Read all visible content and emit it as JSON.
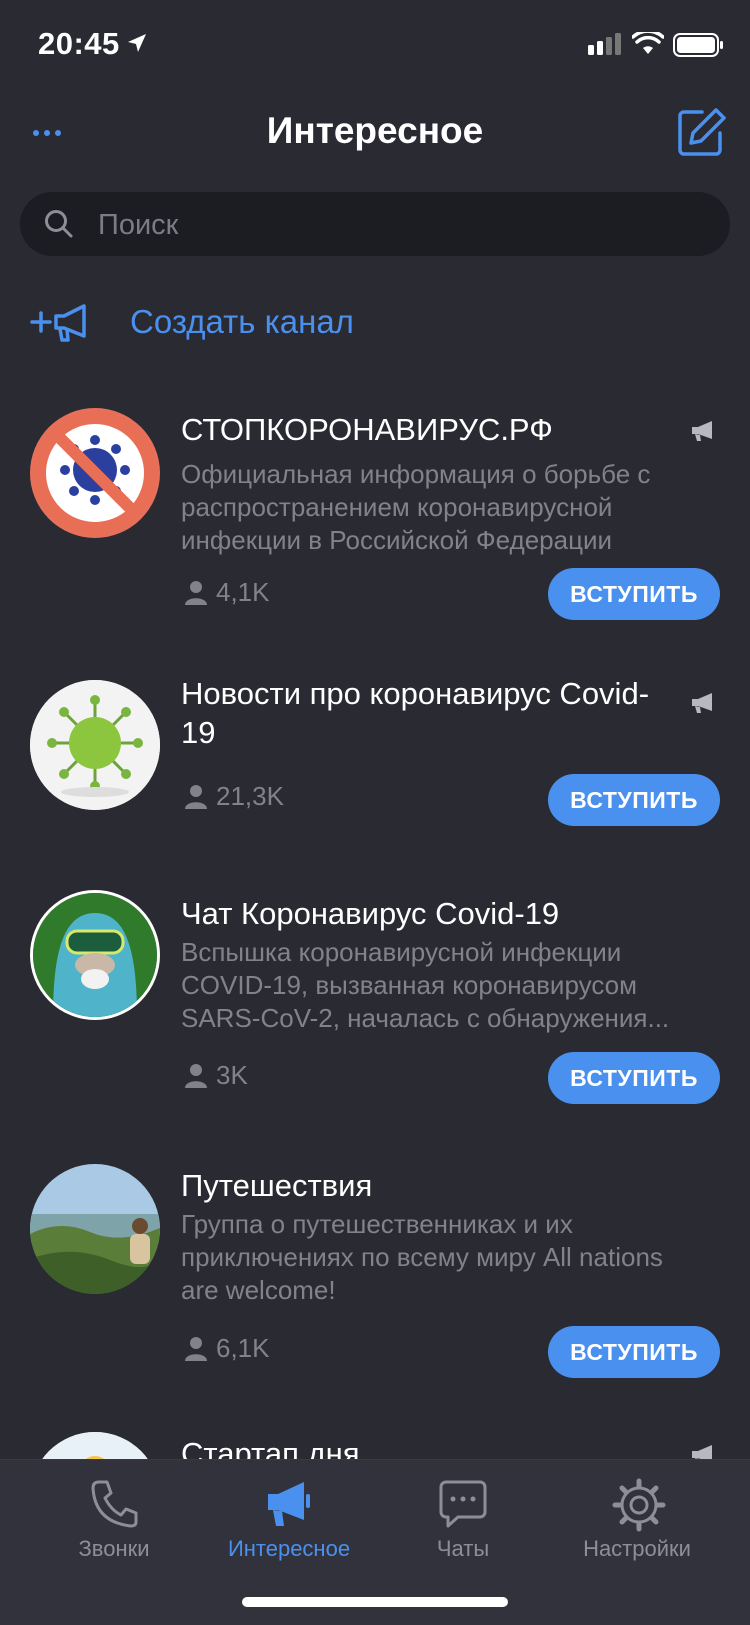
{
  "status": {
    "time": "20:45"
  },
  "header": {
    "title": "Интересное"
  },
  "search": {
    "placeholder": "Поиск"
  },
  "create_channel": {
    "label": "Создать канал"
  },
  "channels": [
    {
      "title": "СТОПКОРОНАВИРУС.РФ",
      "description": "Официальная информация о борьбе с распространением коронавирусной инфекции в Российской Федерации",
      "members": "4,1K",
      "join_label": "ВСТУПИТЬ",
      "is_channel": true
    },
    {
      "title": "Новости про коронавирус Covid-19",
      "description": "",
      "members": "21,3K",
      "join_label": "ВСТУПИТЬ",
      "is_channel": true
    },
    {
      "title": "Чат Коронавирус Covid-19",
      "description": "Вспышка коронавирусной инфекции COVID-19, вызванная коронавирусом SARS-CoV-2, началась с обнаружения...",
      "members": "3K",
      "join_label": "ВСТУПИТЬ",
      "is_channel": false
    },
    {
      "title": "Путешествия",
      "description": "Группа о путешественниках и их приключениях по всему миру  All nations are welcome!",
      "members": "6,1K",
      "join_label": "ВСТУПИТЬ",
      "is_channel": false
    },
    {
      "title": "Стартап дня",
      "is_channel": true
    }
  ],
  "tabs": [
    {
      "label": "Звонки",
      "icon": "phone-icon"
    },
    {
      "label": "Интересное",
      "icon": "megaphone-icon",
      "active": true
    },
    {
      "label": "Чаты",
      "icon": "chat-bubble-icon"
    },
    {
      "label": "Настройки",
      "icon": "gear-icon"
    }
  ],
  "colors": {
    "accent": "#4a90ee",
    "background": "#2a2a33",
    "tabbar": "#32323d",
    "muted": "#82828c"
  }
}
